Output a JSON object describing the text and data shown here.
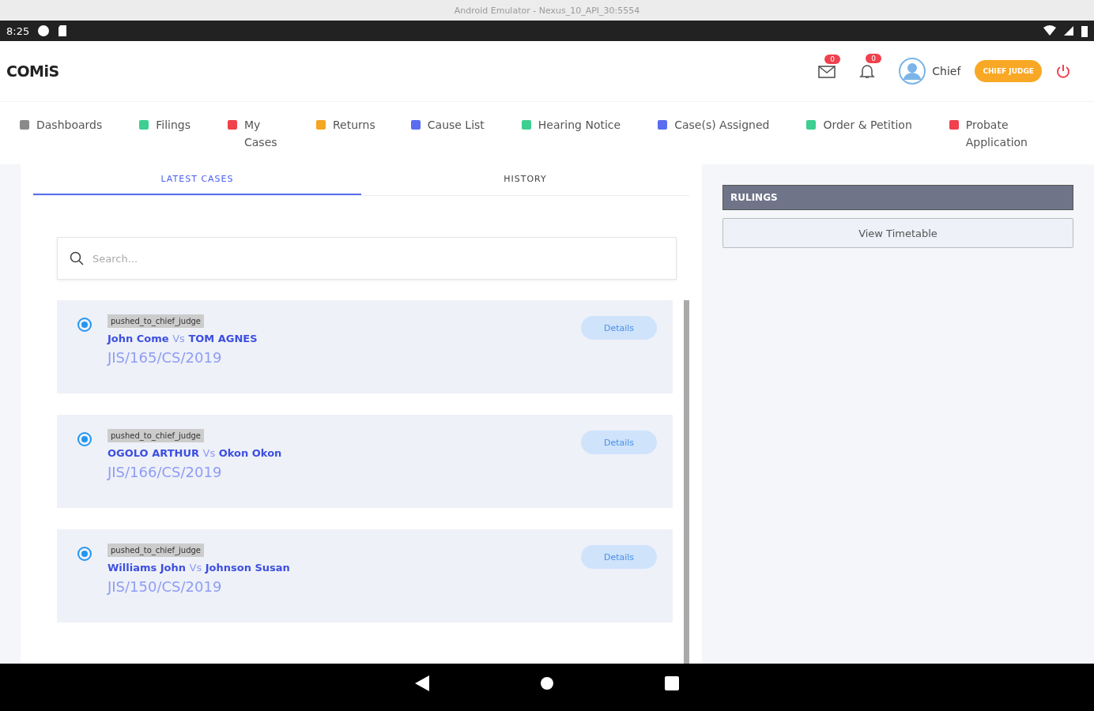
{
  "window": {
    "title": "Android Emulator - Nexus_10_API_30:5554"
  },
  "status_bar": {
    "time": "8:25"
  },
  "header": {
    "logo": "COMiS",
    "messages_badge": "0",
    "notifications_badge": "0",
    "user": "Chief",
    "role": "CHIEF JUDGE"
  },
  "nav": [
    {
      "label": "Dashboards",
      "color": "#8a8a8a"
    },
    {
      "label": "Filings",
      "color": "#3ccf91"
    },
    {
      "label": "My Cases",
      "color": "#f0414d"
    },
    {
      "label": "Returns",
      "color": "#f5a623"
    },
    {
      "label": "Cause List",
      "color": "#5a6cf0"
    },
    {
      "label": "Hearing Notice",
      "color": "#3ccf91"
    },
    {
      "label": "Case(s) Assigned",
      "color": "#5a6cf0"
    },
    {
      "label": "Order & Petition",
      "color": "#3ccf91"
    },
    {
      "label": "Probate Application",
      "color": "#f0414d"
    }
  ],
  "tabs": [
    {
      "label": "LATEST CASES",
      "selected": true
    },
    {
      "label": "HISTORY",
      "selected": false
    }
  ],
  "search": {
    "placeholder": "Search..."
  },
  "cases": [
    {
      "status": "pushed_to_chief_judge",
      "plaintiff": "John Come",
      "versus": "Vs",
      "defendant": "TOM AGNES",
      "number": "JIS/165/CS/2019",
      "action": "Details"
    },
    {
      "status": "pushed_to_chief_judge",
      "plaintiff": "OGOLO ARTHUR",
      "versus": "Vs",
      "defendant": "Okon Okon",
      "number": "JIS/166/CS/2019",
      "action": "Details"
    },
    {
      "status": "pushed_to_chief_judge",
      "plaintiff": "Williams John",
      "versus": "Vs",
      "defendant": "Johnson Susan",
      "number": "JIS/150/CS/2019",
      "action": "Details"
    }
  ],
  "side_panel": {
    "heading": "RULINGS",
    "button": "View Timetable"
  }
}
